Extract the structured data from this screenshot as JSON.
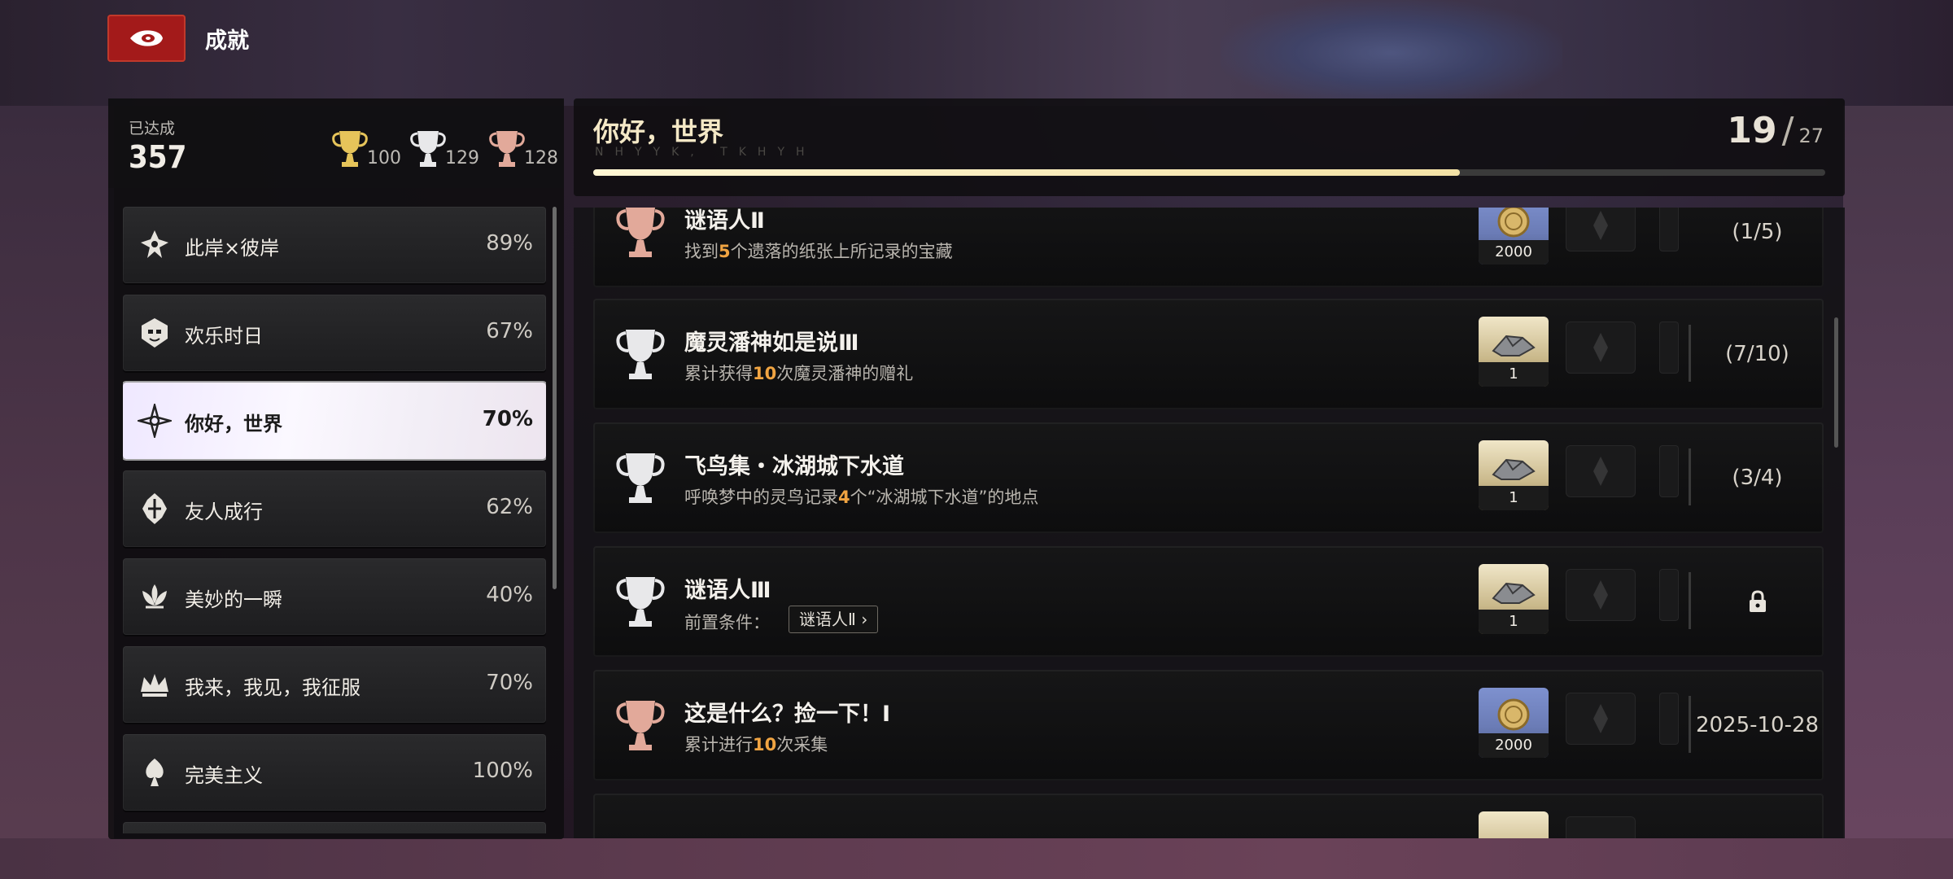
{
  "header": {
    "title": "成就"
  },
  "summary": {
    "achieved_label": "已达成",
    "achieved_count": "357",
    "gold_count": "100",
    "silver_count": "129",
    "bronze_count": "128"
  },
  "categories": [
    {
      "label": "此岸×彼岸",
      "pct": "89%"
    },
    {
      "label": "欢乐时日",
      "pct": "67%"
    },
    {
      "label": "你好，世界",
      "pct": "70%",
      "selected": true
    },
    {
      "label": "友人成行",
      "pct": "62%"
    },
    {
      "label": "美妙的一瞬",
      "pct": "40%"
    },
    {
      "label": "我来，我见，我征服",
      "pct": "70%"
    },
    {
      "label": "完美主义",
      "pct": "100%"
    }
  ],
  "current": {
    "title": "你好，世界",
    "subtitle": "NHYYK, TKHYH",
    "done": "19",
    "total": "27",
    "progress_fraction": 0.7037
  },
  "achievements": [
    {
      "title": "谜语人Ⅱ",
      "desc_pre": "找到",
      "desc_num": "5",
      "desc_post": "个遗落的纸张上所记录的宝藏",
      "trophy": "bronze",
      "reward_type": "coin",
      "reward_qty": "2000",
      "status": "(1/5)"
    },
    {
      "title": "魔灵潘神如是说Ⅲ",
      "desc_pre": "累计获得",
      "desc_num": "10",
      "desc_post": "次魔灵潘神的赠礼",
      "trophy": "silver",
      "reward_type": "item",
      "reward_qty": "1",
      "status": "(7/10)"
    },
    {
      "title": "飞鸟集・冰湖城下水道",
      "desc_pre": "呼唤梦中的灵鸟记录",
      "desc_num": "4",
      "desc_post": "个“冰湖城下水道”的地点",
      "trophy": "silver",
      "reward_type": "item",
      "reward_qty": "1",
      "status": "(3/4)"
    },
    {
      "title": "谜语人Ⅲ",
      "prereq_label": "前置条件：",
      "prereq_chip": "谜语人Ⅱ ›",
      "trophy": "silver",
      "reward_type": "item",
      "reward_qty": "1",
      "status": "",
      "locked": true
    },
    {
      "title": "这是什么？捡一下！Ⅰ",
      "desc_pre": "累计进行",
      "desc_num": "10",
      "desc_post": "次采集",
      "trophy": "bronze",
      "reward_type": "coin",
      "reward_qty": "2000",
      "status": "2025-10-28"
    }
  ],
  "colors": {
    "accent_gold": "#f4e8c6",
    "highlight_orange": "#f0a442",
    "back_button_red": "#a31a1a",
    "trophy_gold": "#e6c45a",
    "trophy_silver": "#e8e8ea",
    "trophy_bronze": "#e2a99a"
  },
  "icons": {
    "back": "back-emblem-icon",
    "trophy_gold": "gold-trophy-icon",
    "trophy_silver": "silver-trophy-icon",
    "trophy_bronze": "bronze-trophy-icon",
    "lock": "lock-icon"
  }
}
